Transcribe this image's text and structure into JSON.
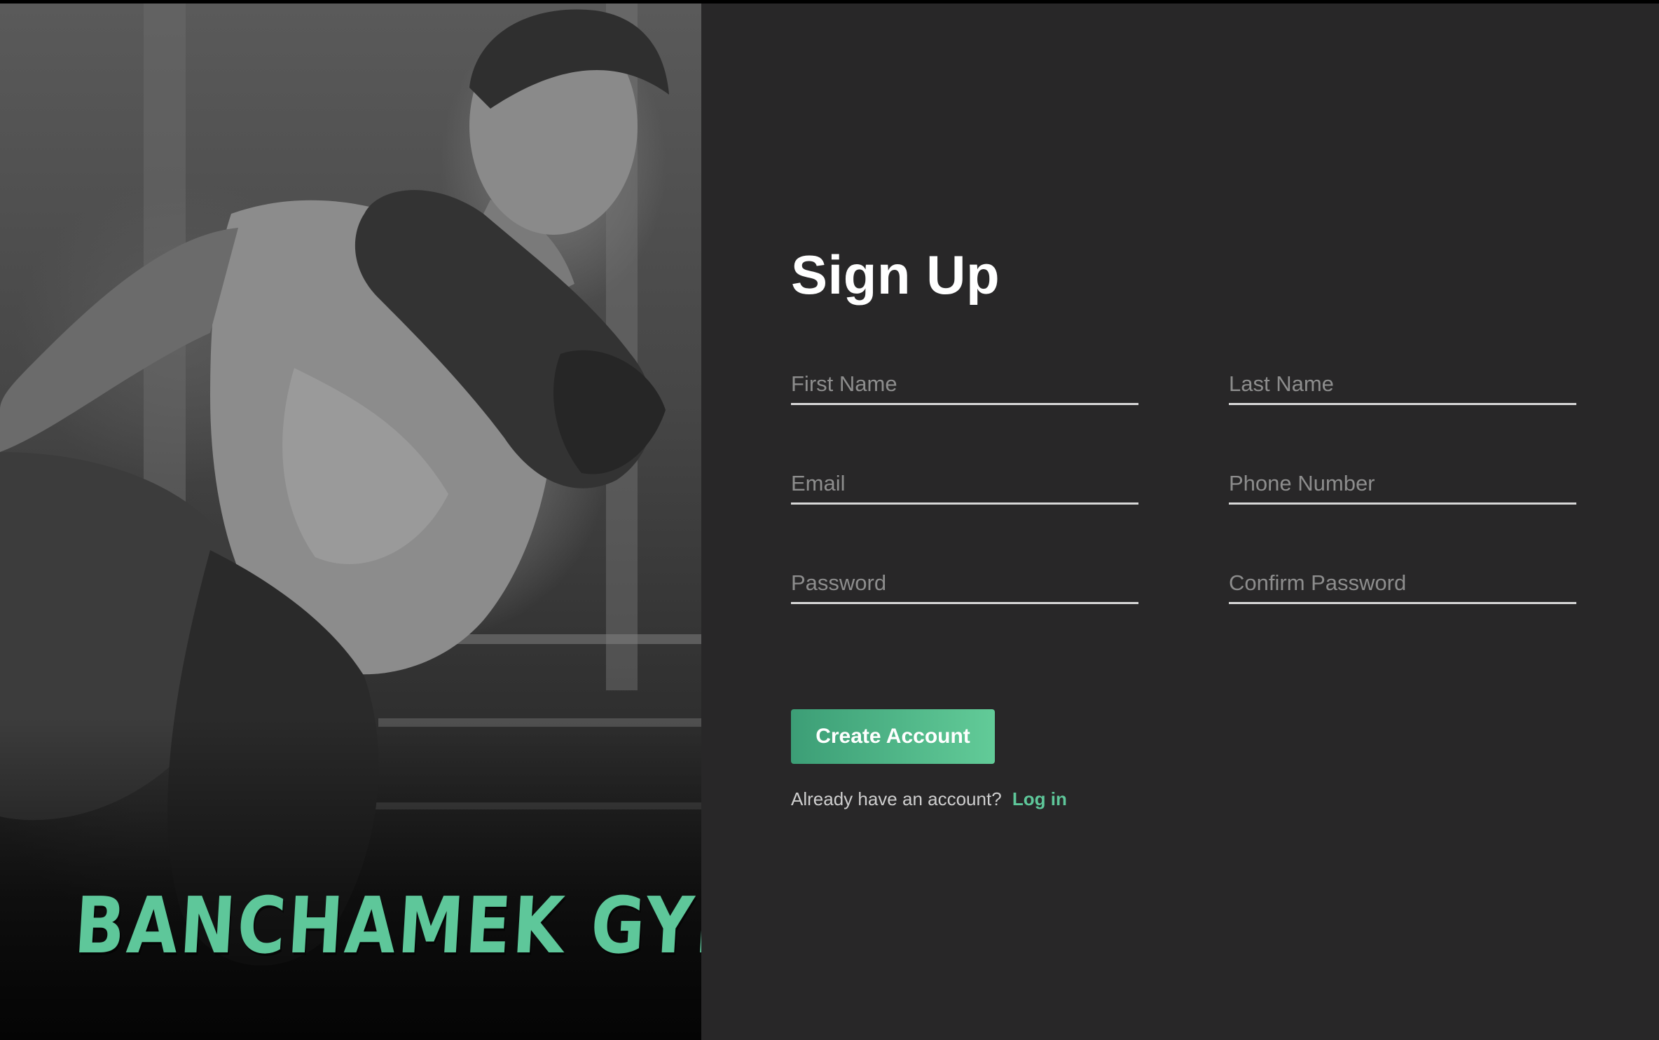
{
  "brand": {
    "name": "BANCHAMEK GYM",
    "color": "#5ec79a"
  },
  "hero": {
    "icon": "fighter-photo",
    "style": "black-and-white"
  },
  "form": {
    "title": "Sign Up",
    "fields": [
      {
        "name": "first-name",
        "placeholder": "First Name",
        "value": ""
      },
      {
        "name": "last-name",
        "placeholder": "Last Name",
        "value": ""
      },
      {
        "name": "email",
        "placeholder": "Email",
        "value": ""
      },
      {
        "name": "phone-number",
        "placeholder": "Phone Number",
        "value": ""
      },
      {
        "name": "password",
        "placeholder": "Password",
        "value": ""
      },
      {
        "name": "confirm-password",
        "placeholder": "Confirm Password",
        "value": ""
      }
    ],
    "submit_label": "Create Account",
    "login_prompt": "Already have an account?",
    "login_link": "Log in"
  },
  "colors": {
    "panel_background": "#282728",
    "accent": "#5ec79a",
    "accent_dark": "#3c9e76",
    "title_text": "#ffffff",
    "placeholder_text": "#8d8d8d"
  }
}
